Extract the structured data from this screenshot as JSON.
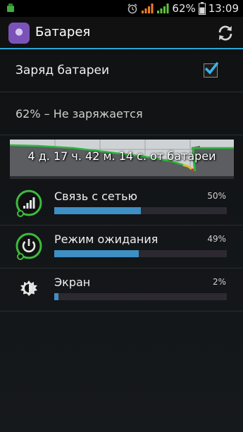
{
  "status_bar": {
    "battery_percent": "62%",
    "time": "13:09"
  },
  "action_bar": {
    "title": "Батарея"
  },
  "charge_setting": {
    "label": "Заряд батареи",
    "checked": true
  },
  "battery_status": {
    "text": "62% – Не заряжается"
  },
  "graph": {
    "text": "4 д. 17 ч. 42 м. 14 с. от батареи"
  },
  "usage_items": [
    {
      "name": "Связь с сетью",
      "percent_label": "50%",
      "percent": 50,
      "icon": "signal-bars-icon"
    },
    {
      "name": "Режим ожидания",
      "percent_label": "49%",
      "percent": 49,
      "icon": "power-icon"
    },
    {
      "name": "Экран",
      "percent_label": "2%",
      "percent": 2,
      "icon": "brightness-icon"
    }
  ],
  "colors": {
    "accent": "#2aa8d8",
    "bar_fill": "#3e8fc4",
    "graph_line": "#2db83d",
    "graph_low": "#d83030"
  }
}
